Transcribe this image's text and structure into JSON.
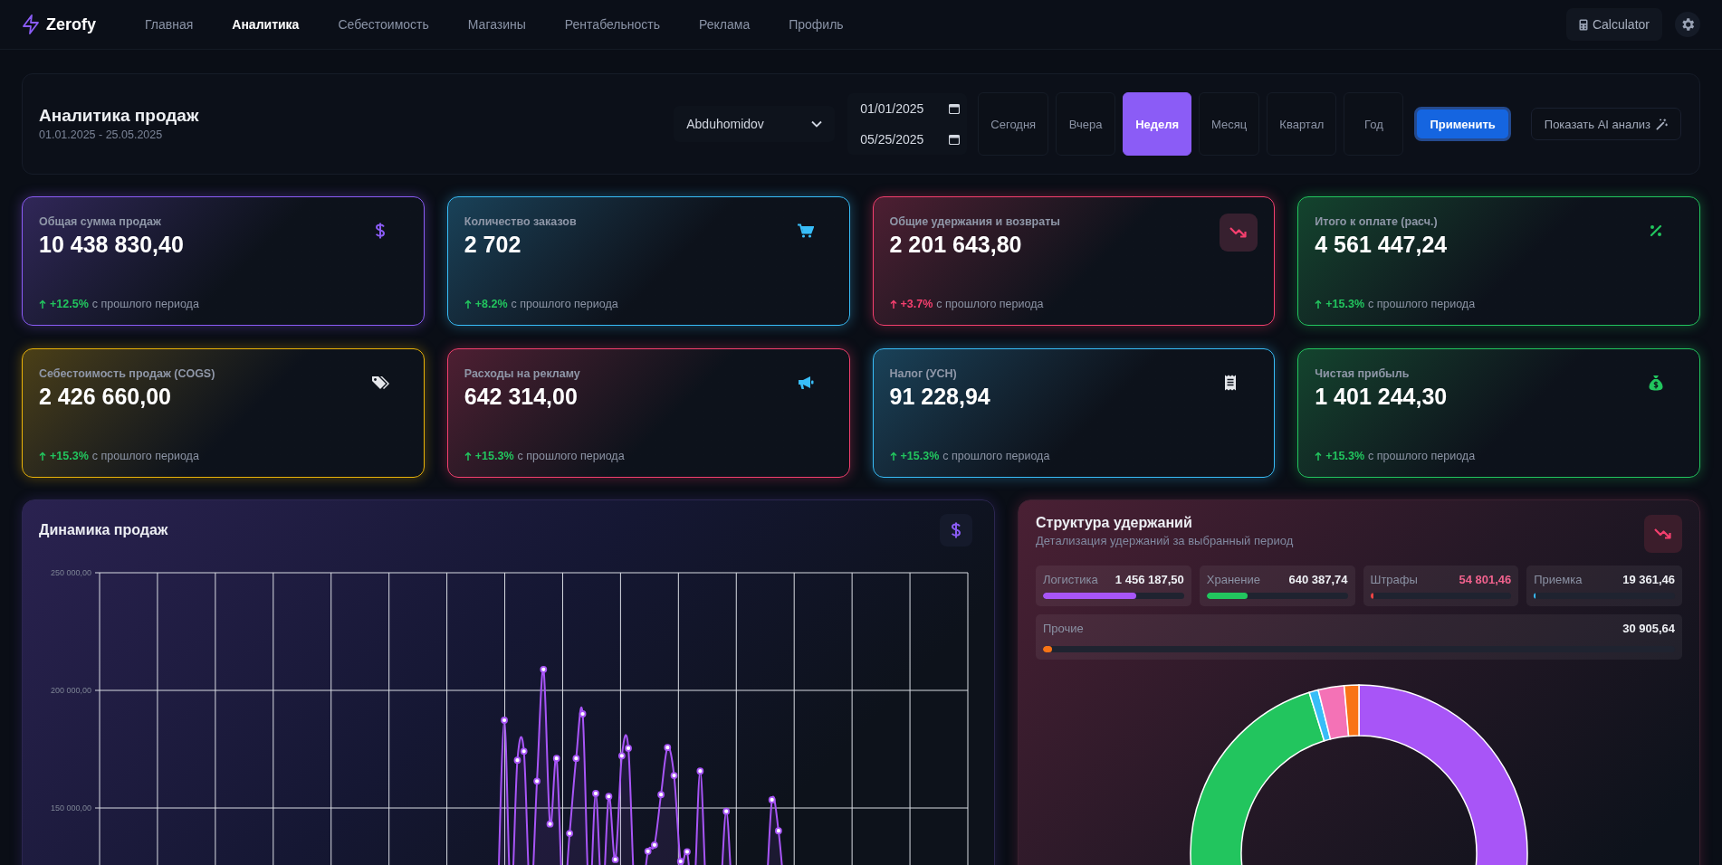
{
  "nav": {
    "logo": "Zerofy",
    "items": [
      {
        "label": "Главная",
        "selected": false
      },
      {
        "label": "Аналитика",
        "selected": true
      },
      {
        "label": "Себестоимость",
        "selected": false
      },
      {
        "label": "Магазины",
        "selected": false
      },
      {
        "label": "Рентабельность",
        "selected": false
      },
      {
        "label": "Реклама",
        "selected": false
      },
      {
        "label": "Профиль",
        "selected": false
      }
    ],
    "calculator": "Calculator"
  },
  "filter": {
    "title": "Аналитика продаж",
    "range": "01.01.2025 - 25.05.2025",
    "store": "Abduhomidov",
    "date_from": "01/01/2025",
    "date_to": "05/25/2025",
    "periods": [
      {
        "label": "Сегодня",
        "selected": false
      },
      {
        "label": "Вчера",
        "selected": false
      },
      {
        "label": "Неделя",
        "selected": true
      },
      {
        "label": "Месяц",
        "selected": false
      },
      {
        "label": "Квартал",
        "selected": false
      },
      {
        "label": "Год",
        "selected": false
      }
    ],
    "apply": "Применить",
    "ai": "Показать AI анализ"
  },
  "cards": [
    {
      "title": "Общая сумма продаж",
      "value": "10 438 830,40",
      "change": "+12.5%",
      "note": "с прошлого периода",
      "color": "#8b5cf6",
      "kind": "dollar",
      "bad": false,
      "boxed": false
    },
    {
      "title": "Количество заказов",
      "value": "2 702",
      "change": "+8.2%",
      "note": "с прошлого периода",
      "color": "#38bdf8",
      "kind": "cart",
      "bad": false,
      "boxed": false
    },
    {
      "title": "Общие удержания и возвраты",
      "value": "2 201 643,80",
      "change": "+3.7%",
      "note": "с прошлого периода",
      "color": "#f43f6e",
      "kind": "trend",
      "bad": true,
      "boxed": true
    },
    {
      "title": "Итого к оплате (расч.)",
      "value": "4 561 447,24",
      "change": "+15.3%",
      "note": "с прошлого периода",
      "color": "#22c55e",
      "kind": "percent",
      "bad": false,
      "boxed": false
    },
    {
      "title": "Себестоимость продаж (COGS)",
      "value": "2 426 660,00",
      "change": "+15.3%",
      "note": "с прошлого периода",
      "color": "#eab308",
      "kind": "tags",
      "bad": false,
      "boxed": false
    },
    {
      "title": "Расходы на рекламу",
      "value": "642 314,00",
      "change": "+15.3%",
      "note": "с прошлого периода",
      "color": "#f43f6e",
      "kind": "megaphone",
      "bad": false,
      "boxed": false
    },
    {
      "title": "Налог (УСН)",
      "value": "91 228,94",
      "change": "+15.3%",
      "note": "с прошлого периода",
      "color": "#38bdf8",
      "kind": "receipt",
      "bad": false,
      "boxed": false
    },
    {
      "title": "Чистая прибыль",
      "value": "1 401 244,30",
      "change": "+15.3%",
      "note": "с прошлого периода",
      "color": "#22c55e",
      "kind": "moneybag",
      "bad": false,
      "boxed": false
    }
  ],
  "sales_chart": {
    "title": "Динамика продаж",
    "chart_data": {
      "type": "area",
      "ylim": [
        0,
        250000
      ],
      "yticks": [
        {
          "value": 150000,
          "label": "150 000,00"
        },
        {
          "value": 200000,
          "label": "200 000,00"
        },
        {
          "value": 250000,
          "label": "250 000,00"
        }
      ],
      "categories": [
        null,
        null,
        null,
        null,
        null,
        null,
        null,
        null,
        null,
        null,
        null,
        null,
        null,
        null,
        null,
        null,
        null,
        null,
        null,
        null,
        null,
        null,
        null,
        null,
        null,
        null,
        null,
        null,
        null,
        null,
        null,
        null,
        null,
        null,
        null,
        null,
        null,
        null,
        null,
        null,
        null,
        null,
        null,
        null,
        null,
        null,
        null,
        null,
        null,
        null,
        null,
        null,
        null,
        null,
        null,
        null,
        null,
        null,
        null,
        null,
        null,
        null,
        null,
        null,
        null,
        null,
        null,
        null,
        null,
        null,
        null,
        null,
        null,
        null,
        null,
        null,
        null,
        null,
        null,
        null,
        null,
        null,
        null,
        null,
        null,
        null,
        null,
        null,
        null,
        null,
        null,
        null,
        null,
        null,
        null,
        null,
        null,
        null,
        null,
        null,
        null,
        null,
        null,
        null,
        null,
        null,
        null,
        null,
        null,
        null,
        null,
        null,
        null,
        null,
        null,
        null,
        null,
        null,
        null,
        null,
        null,
        null,
        null,
        null,
        null,
        null,
        null,
        null,
        null,
        null,
        null,
        null,
        null,
        null
      ],
      "series": [
        {
          "color": "#a855f7",
          "values": [
            null,
            null,
            null,
            null,
            null,
            null,
            null,
            null,
            null,
            null,
            null,
            null,
            null,
            null,
            null,
            null,
            null,
            null,
            null,
            null,
            null,
            null,
            null,
            null,
            null,
            null,
            null,
            null,
            null,
            null,
            null,
            null,
            null,
            null,
            null,
            null,
            null,
            null,
            null,
            null,
            null,
            null,
            null,
            null,
            null,
            null,
            null,
            null,
            null,
            null,
            null,
            null,
            null,
            null,
            null,
            null,
            null,
            null,
            null,
            null,
            null,
            110000,
            187300,
            110000,
            170300,
            174100,
            110000,
            161400,
            208900,
            143200,
            171100,
            110000,
            139200,
            171100,
            190000,
            110000,
            156200,
            110000,
            154900,
            128100,
            172200,
            175400,
            110000,
            110000,
            131600,
            134300,
            155700,
            175700,
            163800,
            127300,
            131400,
            110000,
            165700,
            110000,
            110000,
            110000,
            148600,
            110000,
            110000,
            110000,
            110000,
            110000,
            110000,
            153500,
            140300,
            110000,
            null,
            null,
            null,
            null,
            null,
            null,
            null,
            null,
            null,
            null,
            null,
            null,
            null,
            null,
            null,
            null,
            null,
            null,
            null,
            null,
            null,
            null,
            null,
            null,
            null,
            null,
            null,
            null
          ]
        }
      ]
    }
  },
  "deductions": {
    "title": "Структура удержаний",
    "subtitle": "Детализация удержаний за выбранный период",
    "items": [
      {
        "label": "Логистика",
        "value": "1 456 187,50",
        "level": 0.66,
        "color": "#a855f7",
        "alert": false
      },
      {
        "label": "Хранение",
        "value": "640 387,74",
        "level": 0.29,
        "color": "#22c55e",
        "alert": false
      },
      {
        "label": "Штрафы",
        "value": "54 801,46",
        "level": 0.025,
        "color": "#ef4444",
        "alert": true
      },
      {
        "label": "Приемка",
        "value": "19 361,46",
        "level": 0.009,
        "color": "#38bdf8",
        "alert": false
      },
      {
        "label": "Прочие",
        "value": "30 905,64",
        "level": 0.014,
        "color": "#f97316",
        "alert": false
      }
    ],
    "chart_data": {
      "type": "donut",
      "values": [
        66.14,
        29.09,
        0.88,
        2.49,
        1.4
      ],
      "colors": [
        "#a855f7",
        "#22c55e",
        "#38bdf8",
        "#f472b6",
        "#f97316"
      ]
    }
  }
}
